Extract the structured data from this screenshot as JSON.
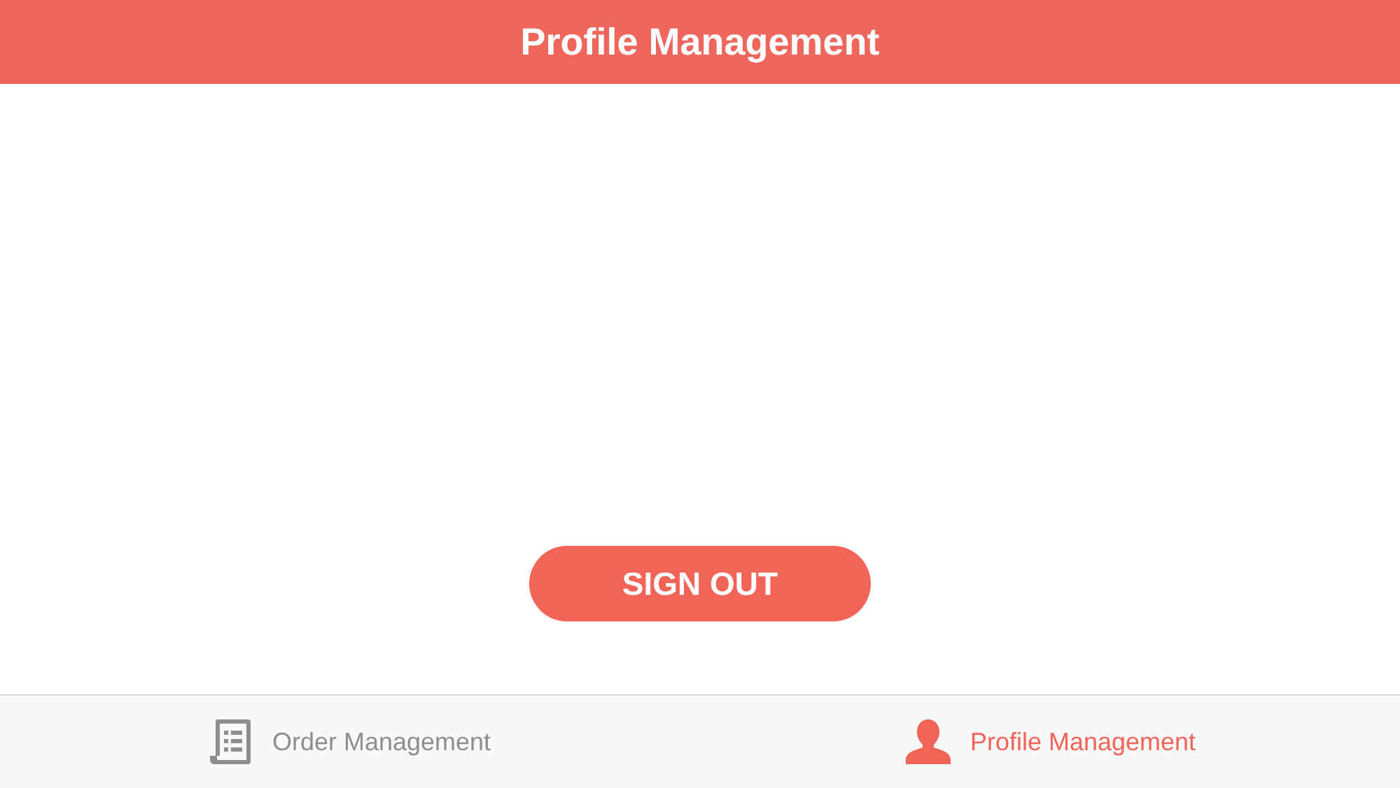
{
  "header": {
    "title": "Profile Management"
  },
  "sign_out_button": {
    "label": "SIGN OUT"
  },
  "tab_bar": {
    "tabs": [
      {
        "kind": "document",
        "label": "Order Management",
        "selected": false
      },
      {
        "kind": "person",
        "label": "Profile Management",
        "selected": true
      }
    ]
  }
}
